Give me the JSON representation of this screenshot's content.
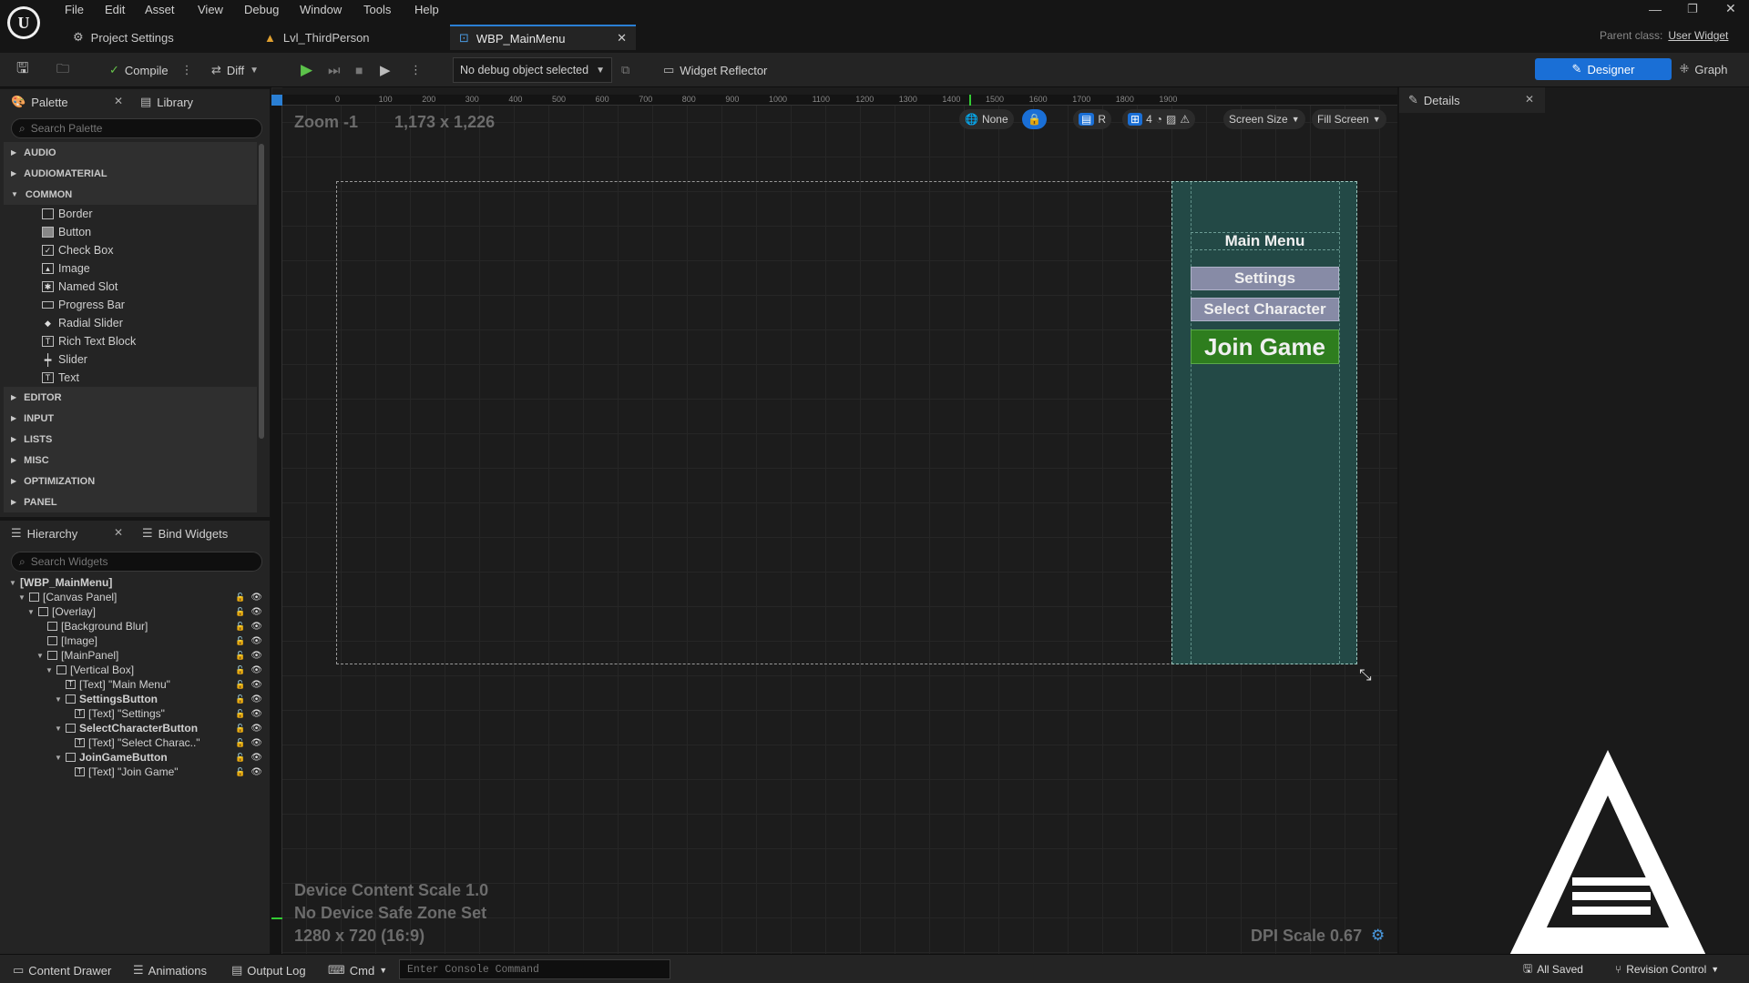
{
  "menu": [
    "File",
    "Edit",
    "Asset",
    "View",
    "Debug",
    "Window",
    "Tools",
    "Help"
  ],
  "tabs": [
    {
      "label": "Project Settings",
      "active": false
    },
    {
      "label": "Lvl_ThirdPerson",
      "active": false
    },
    {
      "label": "WBP_MainMenu",
      "active": true
    }
  ],
  "parent_class": {
    "label": "Parent class:",
    "value": "User Widget"
  },
  "toolbar": {
    "compile": "Compile",
    "diff": "Diff",
    "debug_select": "No debug object selected",
    "widget_reflector": "Widget Reflector",
    "designer": "Designer",
    "graph": "Graph"
  },
  "palette": {
    "tab": "Palette",
    "library_tab": "Library",
    "search_placeholder": "Search Palette",
    "categories_top": [
      "AUDIO",
      "AUDIOMATERIAL"
    ],
    "common_label": "COMMON",
    "common_items": [
      "Border",
      "Button",
      "Check Box",
      "Image",
      "Named Slot",
      "Progress Bar",
      "Radial Slider",
      "Rich Text Block",
      "Slider",
      "Text"
    ],
    "categories_bottom": [
      "EDITOR",
      "INPUT",
      "LISTS",
      "MISC",
      "OPTIMIZATION",
      "PANEL"
    ]
  },
  "hierarchy": {
    "tab": "Hierarchy",
    "bind_tab": "Bind Widgets",
    "search_placeholder": "Search Widgets",
    "rows": [
      {
        "label": "[WBP_MainMenu]",
        "depth": 0,
        "bold": true
      },
      {
        "label": "[Canvas Panel]",
        "depth": 1
      },
      {
        "label": "[Overlay]",
        "depth": 2
      },
      {
        "label": "[Background Blur]",
        "depth": 3
      },
      {
        "label": "[Image]",
        "depth": 3
      },
      {
        "label": "[MainPanel]",
        "depth": 3
      },
      {
        "label": "[Vertical Box]",
        "depth": 4
      },
      {
        "label": "[Text] \"Main Menu\"",
        "depth": 5
      },
      {
        "label": "SettingsButton",
        "depth": 5,
        "bold": true
      },
      {
        "label": "[Text] \"Settings\"",
        "depth": 6
      },
      {
        "label": "SelectCharacterButton",
        "depth": 5,
        "bold": true
      },
      {
        "label": "[Text] \"Select Charac..\"",
        "depth": 6
      },
      {
        "label": "JoinGameButton",
        "depth": 5,
        "bold": true
      },
      {
        "label": "[Text] \"Join Game\"",
        "depth": 6
      }
    ]
  },
  "designer": {
    "zoom": "Zoom -1",
    "size": "1,173 x 1,226",
    "none_btn": "None",
    "r_btn": "R",
    "grid_count": "4",
    "screen_size": "Screen Size",
    "fill_screen": "Fill Screen",
    "ruler_top": [
      "0",
      "100",
      "200",
      "300",
      "400",
      "500",
      "600",
      "700",
      "800",
      "900",
      "1000",
      "1100",
      "1200",
      "1300",
      "1400",
      "1500",
      "1600",
      "1700",
      "1800",
      "1900"
    ],
    "device_content_scale": "Device Content Scale 1.0",
    "safe_zone": "No Device Safe Zone Set",
    "resolution": "1280 x 720 (16:9)",
    "dpi_scale": "DPI Scale 0.67",
    "widget": {
      "title": "Main Menu",
      "settings": "Settings",
      "select_character": "Select Character",
      "join_game": "Join Game"
    }
  },
  "details": {
    "tab": "Details"
  },
  "bottom": {
    "content_drawer": "Content Drawer",
    "animations": "Animations",
    "output_log": "Output Log",
    "cmd": "Cmd",
    "console_placeholder": "Enter Console Command",
    "all_saved": "All Saved",
    "revision_control": "Revision Control"
  },
  "colors": {
    "accent": "#2a7fd4",
    "panel_bg": "#234946",
    "button_gray": "#8a8fa8",
    "join_green": "#2e7d1e"
  }
}
